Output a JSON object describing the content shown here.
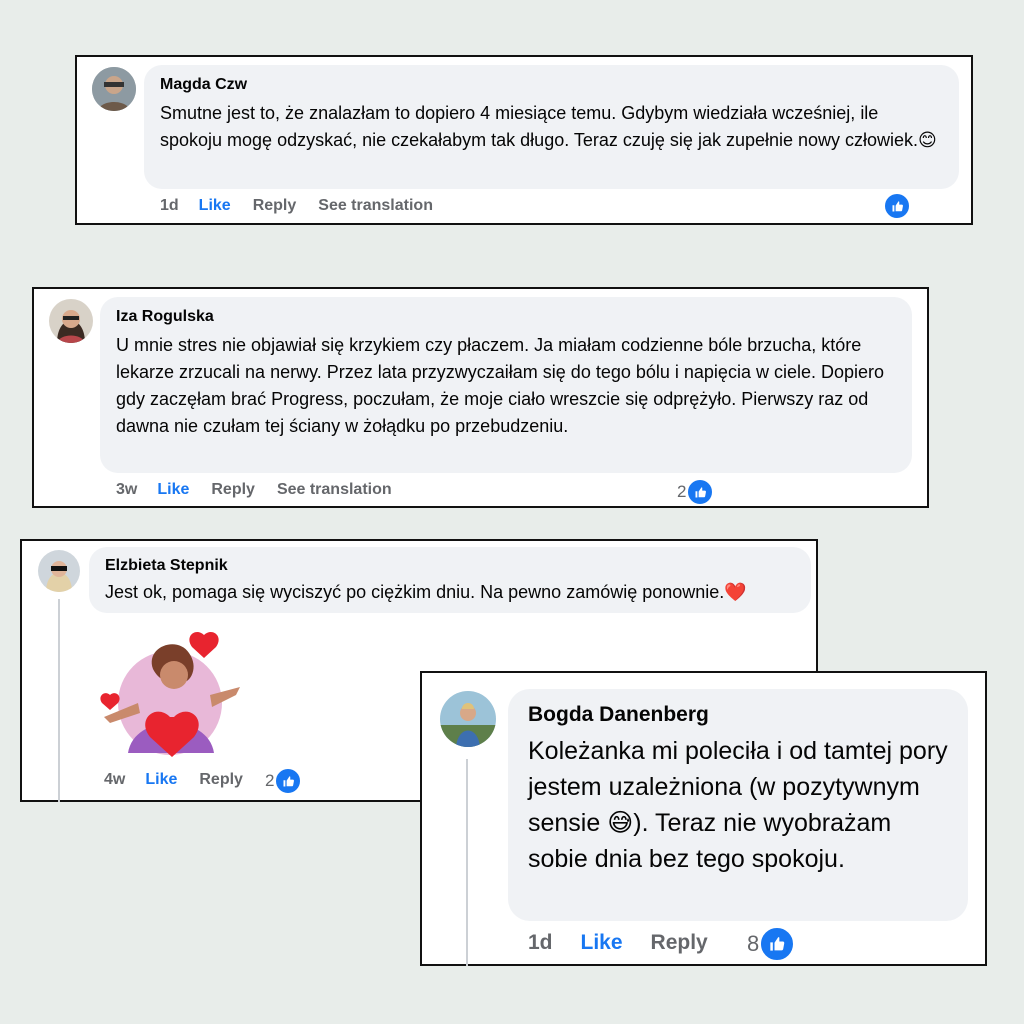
{
  "comments": [
    {
      "author": "Magda Czw",
      "text": "Smutne jest to, że znalazłam to dopiero 4 miesiące temu. Gdybym wiedziała wcześniej, ile spokoju mogę odzyskać, nie czekałabym tak długo. Teraz czuję się jak zupełnie nowy człowiek.😊",
      "time": "1d",
      "like": "Like",
      "reply": "Reply",
      "translate": "See translation",
      "reactions": ""
    },
    {
      "author": "Iza Rogulska",
      "text": "U mnie stres nie objawiał się krzykiem czy płaczem. Ja miałam codzienne bóle brzucha, które lekarze zrzucali na nerwy. Przez lata przyzwyczaiłam się do tego bólu i napięcia w ciele. Dopiero gdy zaczęłam brać Progress, poczułam, że moje ciało wreszcie się odprężyło. Pierwszy raz od dawna nie czułam tej ściany w żołądku po przebudzeniu.",
      "time": "3w",
      "like": "Like",
      "reply": "Reply",
      "translate": "See translation",
      "reactions": "2"
    },
    {
      "author": "Elzbieta Stepnik",
      "text": "Jest ok, pomaga się wyciszyć po ciężkim dniu. Na pewno zamówię ponownie.❤️",
      "time": "4w",
      "like": "Like",
      "reply": "Reply",
      "reactions": "2"
    },
    {
      "author": "Bogda Danenberg",
      "text": "Koleżanka mi poleciła i od tamtej pory jestem uzależniona (w pozytywnym sensie 😅). Teraz nie wyobrażam sobie dnia bez tego spokoju.",
      "time": "1d",
      "like": "Like",
      "reply": "Reply",
      "reactions": "8"
    }
  ],
  "icons": {
    "like_badge": "thumbs-up-icon",
    "avatar": "avatar",
    "sticker": "avatar-sticker-with-hearts"
  },
  "colors": {
    "background": "#e8edea",
    "bubble": "#f0f2f5",
    "link": "#1877f2",
    "meta": "#65676b"
  }
}
